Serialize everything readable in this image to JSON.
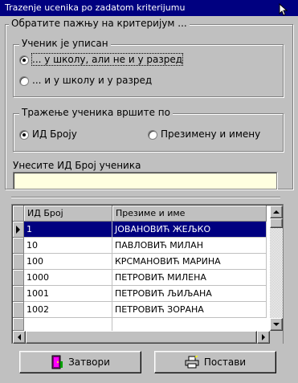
{
  "window": {
    "title": "Trazenje ucenika po zadatom kriterijumu"
  },
  "instruction_group": {
    "label": "Обратите пажњу на критеријум ..."
  },
  "enrolled_group": {
    "label": "Ученик је уписан",
    "options": [
      {
        "label": "... у школу, али не и у разред",
        "checked": true
      },
      {
        "label": "... и у школу и у разред",
        "checked": false
      }
    ]
  },
  "search_by_group": {
    "label": "Тражење ученика вршите по",
    "options": [
      {
        "label": "ИД Броју",
        "checked": true
      },
      {
        "label": "Презимену и имену",
        "checked": false
      }
    ]
  },
  "id_input": {
    "label": "Унесите ИД Број ученика",
    "value": ""
  },
  "table": {
    "columns": [
      "ИД Број",
      "Презиме и име"
    ],
    "rows": [
      {
        "id": "1",
        "name": "ЈОВАНОВИЋ ЖЕЉКО",
        "selected": true
      },
      {
        "id": "10",
        "name": "ПАВЛОВИЋ МИЛАН",
        "selected": false
      },
      {
        "id": "100",
        "name": "КРСМАНОВИЋ МАРИНА",
        "selected": false
      },
      {
        "id": "1000",
        "name": "ПЕТРОВИЋ МИЛЕНА",
        "selected": false
      },
      {
        "id": "1001",
        "name": "ПЕТРОВИЋ ЉИЉАНА",
        "selected": false
      },
      {
        "id": "1002",
        "name": "ПЕТРОВИЋ ЗОРАНА",
        "selected": false
      }
    ]
  },
  "buttons": {
    "close": {
      "label": "Затвори",
      "icon": "door-exit-icon"
    },
    "set": {
      "label": "Постави",
      "icon": "printer-icon"
    }
  },
  "colors": {
    "titlebar": "#000080",
    "selection": "#000080",
    "input_bg": "#ffffe0"
  }
}
